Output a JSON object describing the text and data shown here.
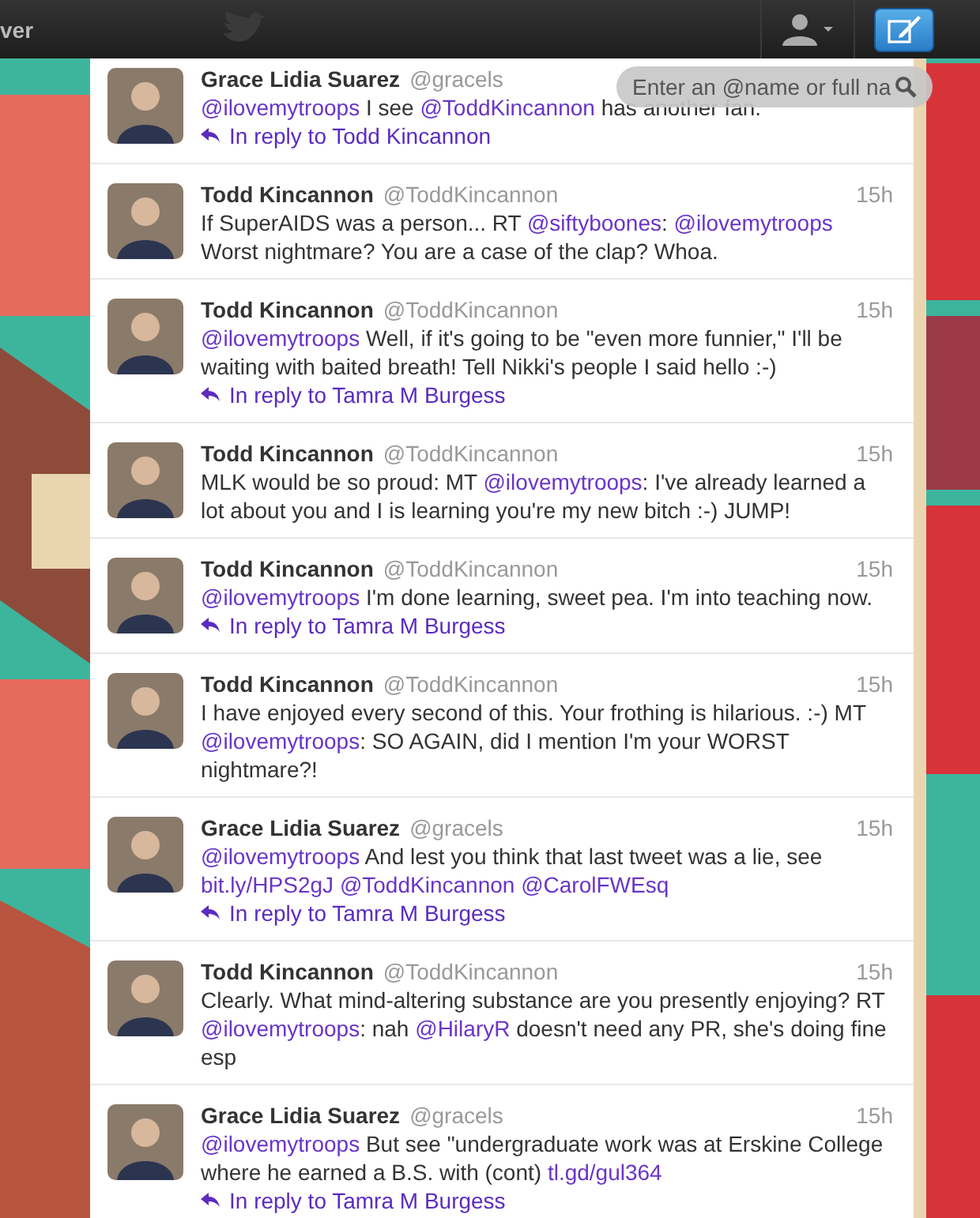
{
  "top_bar": {
    "nav_label": "ver"
  },
  "search": {
    "placeholder": "Enter an @name or full na"
  },
  "tweets": [
    {
      "name": "Grace Lidia Suarez",
      "handle": "@gracels",
      "text": [
        {
          "text": "@ilovemytroops",
          "kind": "link"
        },
        {
          "text": " I see ",
          "kind": "plain"
        },
        {
          "text": "@ToddKincannon",
          "kind": "link"
        },
        {
          "text": " has another fan.",
          "kind": "plain"
        }
      ],
      "reply": "In reply to Todd Kincannon"
    },
    {
      "name": "Todd Kincannon",
      "handle": "@ToddKincannon",
      "time": "15h",
      "text": [
        {
          "text": "If SuperAIDS was a person... RT ",
          "kind": "plain"
        },
        {
          "text": "@siftyboones",
          "kind": "link"
        },
        {
          "text": ": ",
          "kind": "plain"
        },
        {
          "text": "@ilovemytroops",
          "kind": "link"
        },
        {
          "text": " Worst nightmare? You are a case of the clap? Whoa.",
          "kind": "plain"
        }
      ]
    },
    {
      "name": "Todd Kincannon",
      "handle": "@ToddKincannon",
      "time": "15h",
      "text": [
        {
          "text": "@ilovemytroops",
          "kind": "link"
        },
        {
          "text": " Well, if it's going to be \"even more funnier,\" I'll be waiting with baited breath! Tell Nikki's people I said hello :-)",
          "kind": "plain"
        }
      ],
      "reply": "In reply to Tamra M Burgess"
    },
    {
      "name": "Todd Kincannon",
      "handle": "@ToddKincannon",
      "time": "15h",
      "text": [
        {
          "text": "MLK would be so proud: MT ",
          "kind": "plain"
        },
        {
          "text": "@ilovemytroops",
          "kind": "link"
        },
        {
          "text": ": I've already learned a lot about you and I is learning you're my new bitch :-) JUMP!",
          "kind": "plain"
        }
      ]
    },
    {
      "name": "Todd Kincannon",
      "handle": "@ToddKincannon",
      "time": "15h",
      "text": [
        {
          "text": "@ilovemytroops",
          "kind": "link"
        },
        {
          "text": " I'm done learning, sweet pea. I'm into teaching now.",
          "kind": "plain"
        }
      ],
      "reply": "In reply to Tamra M Burgess"
    },
    {
      "name": "Todd Kincannon",
      "handle": "@ToddKincannon",
      "time": "15h",
      "text": [
        {
          "text": "I have enjoyed every second of this. Your frothing is hilarious. :-) MT ",
          "kind": "plain"
        },
        {
          "text": "@ilovemytroops",
          "kind": "link"
        },
        {
          "text": ": SO AGAIN, did I mention I'm your WORST nightmare?!",
          "kind": "plain"
        }
      ]
    },
    {
      "name": "Grace Lidia Suarez",
      "handle": "@gracels",
      "time": "15h",
      "text": [
        {
          "text": "@ilovemytroops",
          "kind": "link"
        },
        {
          "text": " And lest you think that last tweet was a lie, see ",
          "kind": "plain"
        },
        {
          "text": "bit.ly/HPS2gJ ",
          "kind": "link"
        },
        {
          "text": "@ToddKincannon ",
          "kind": "link"
        },
        {
          "text": "@CarolFWEsq",
          "kind": "link"
        }
      ],
      "reply": "In reply to Tamra M Burgess"
    },
    {
      "name": "Todd Kincannon",
      "handle": "@ToddKincannon",
      "time": "15h",
      "text": [
        {
          "text": "Clearly. What mind-altering substance are you presently enjoying? RT ",
          "kind": "plain"
        },
        {
          "text": "@ilovemytroops",
          "kind": "link"
        },
        {
          "text": ": nah ",
          "kind": "plain"
        },
        {
          "text": "@HilaryR",
          "kind": "link"
        },
        {
          "text": " doesn't need any PR, she's doing fine esp",
          "kind": "plain"
        }
      ]
    },
    {
      "name": "Grace Lidia Suarez",
      "handle": "@gracels",
      "time": "15h",
      "text": [
        {
          "text": "@ilovemytroops",
          "kind": "link"
        },
        {
          "text": " But see \"undergraduate work was at Erskine College where he earned a B.S. with (cont) ",
          "kind": "plain"
        },
        {
          "text": "tl.gd/gul364",
          "kind": "link"
        }
      ],
      "reply": "In reply to Tamra M Burgess"
    }
  ]
}
